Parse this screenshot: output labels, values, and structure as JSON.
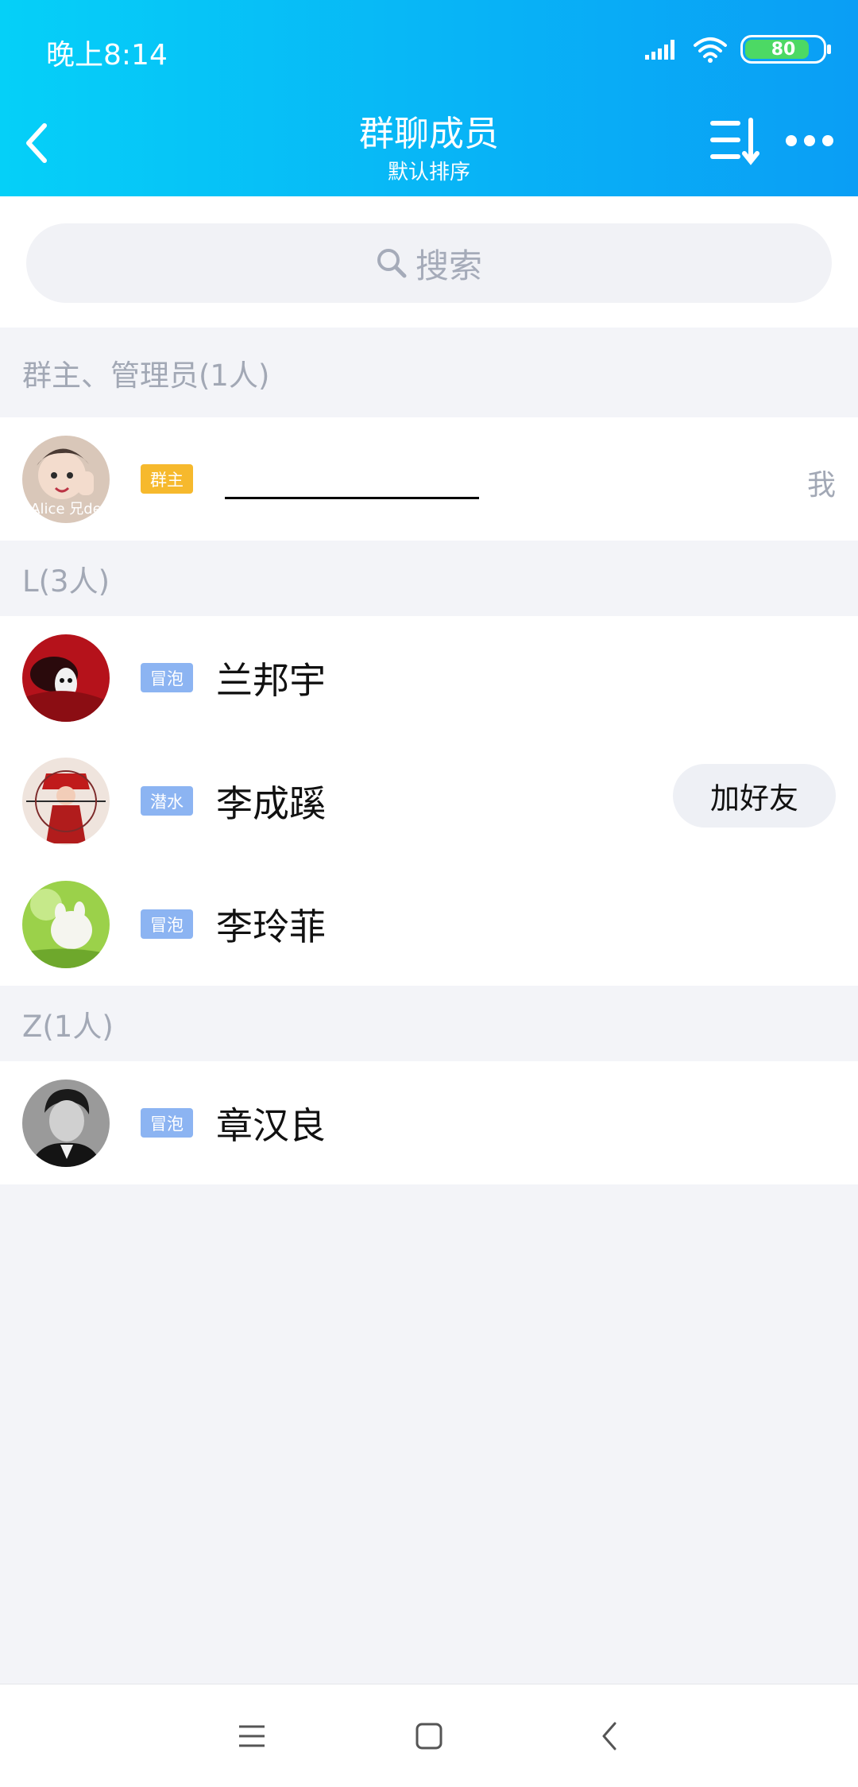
{
  "status_bar": {
    "time": "晚上8:14",
    "battery": "80"
  },
  "header": {
    "title": "群聊成员",
    "subtitle": "默认排序"
  },
  "search": {
    "placeholder": "搜索"
  },
  "sections": [
    {
      "title": "群主、管理员(1人)"
    },
    {
      "title": "L(3人)"
    },
    {
      "title": "Z(1人)"
    }
  ],
  "members": [
    {
      "tag": "群主",
      "name": "",
      "right_label": "我",
      "avatar_text": "Alice 兄de"
    },
    {
      "tag": "冒泡",
      "name": "兰邦宇"
    },
    {
      "tag": "潜水",
      "name": "李成蹊",
      "action": "加好友"
    },
    {
      "tag": "冒泡",
      "name": "李玲菲"
    },
    {
      "tag": "冒泡",
      "name": "章汉良"
    }
  ],
  "colors": {
    "header_start": "#05d0f8",
    "header_end": "#0a9ef5",
    "owner_tag": "#f6b92d",
    "level_tag": "#8cb4f2"
  }
}
